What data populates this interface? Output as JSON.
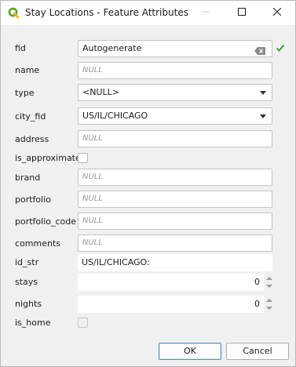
{
  "window": {
    "title": "Stay Locations - Feature Attributes"
  },
  "fields": {
    "fid": {
      "label": "fid",
      "value": "Autogenerate"
    },
    "name": {
      "label": "name",
      "placeholder": "NULL"
    },
    "type": {
      "label": "type",
      "value": "<NULL>"
    },
    "city_fid": {
      "label": "city_fid",
      "value": "US/IL/CHICAGO"
    },
    "address": {
      "label": "address",
      "placeholder": "NULL"
    },
    "is_approximate": {
      "label": "is_approximate",
      "checked": false
    },
    "brand": {
      "label": "brand",
      "placeholder": "NULL"
    },
    "portfolio": {
      "label": "portfolio",
      "placeholder": "NULL"
    },
    "portfolio_code": {
      "label": "portfolio_code",
      "placeholder": "NULL"
    },
    "comments": {
      "label": "comments",
      "placeholder": "NULL"
    },
    "id_str": {
      "label": "id_str",
      "value": "US/IL/CHICAGO:"
    },
    "stays": {
      "label": "stays",
      "value": "0"
    },
    "nights": {
      "label": "nights",
      "value": "0"
    },
    "is_home": {
      "label": "is_home",
      "checked": false
    }
  },
  "buttons": {
    "ok": "OK",
    "cancel": "Cancel"
  },
  "icons": {
    "app": "qgis-icon",
    "minimize": "minimize-icon",
    "maximize": "maximize-icon",
    "close": "close-icon",
    "clear": "clear-field-icon",
    "valid": "checkmark-icon"
  },
  "colors": {
    "qgis_green": "#5aa02c",
    "valid_green": "#2e9a2e",
    "ok_border": "#4a90d9"
  }
}
